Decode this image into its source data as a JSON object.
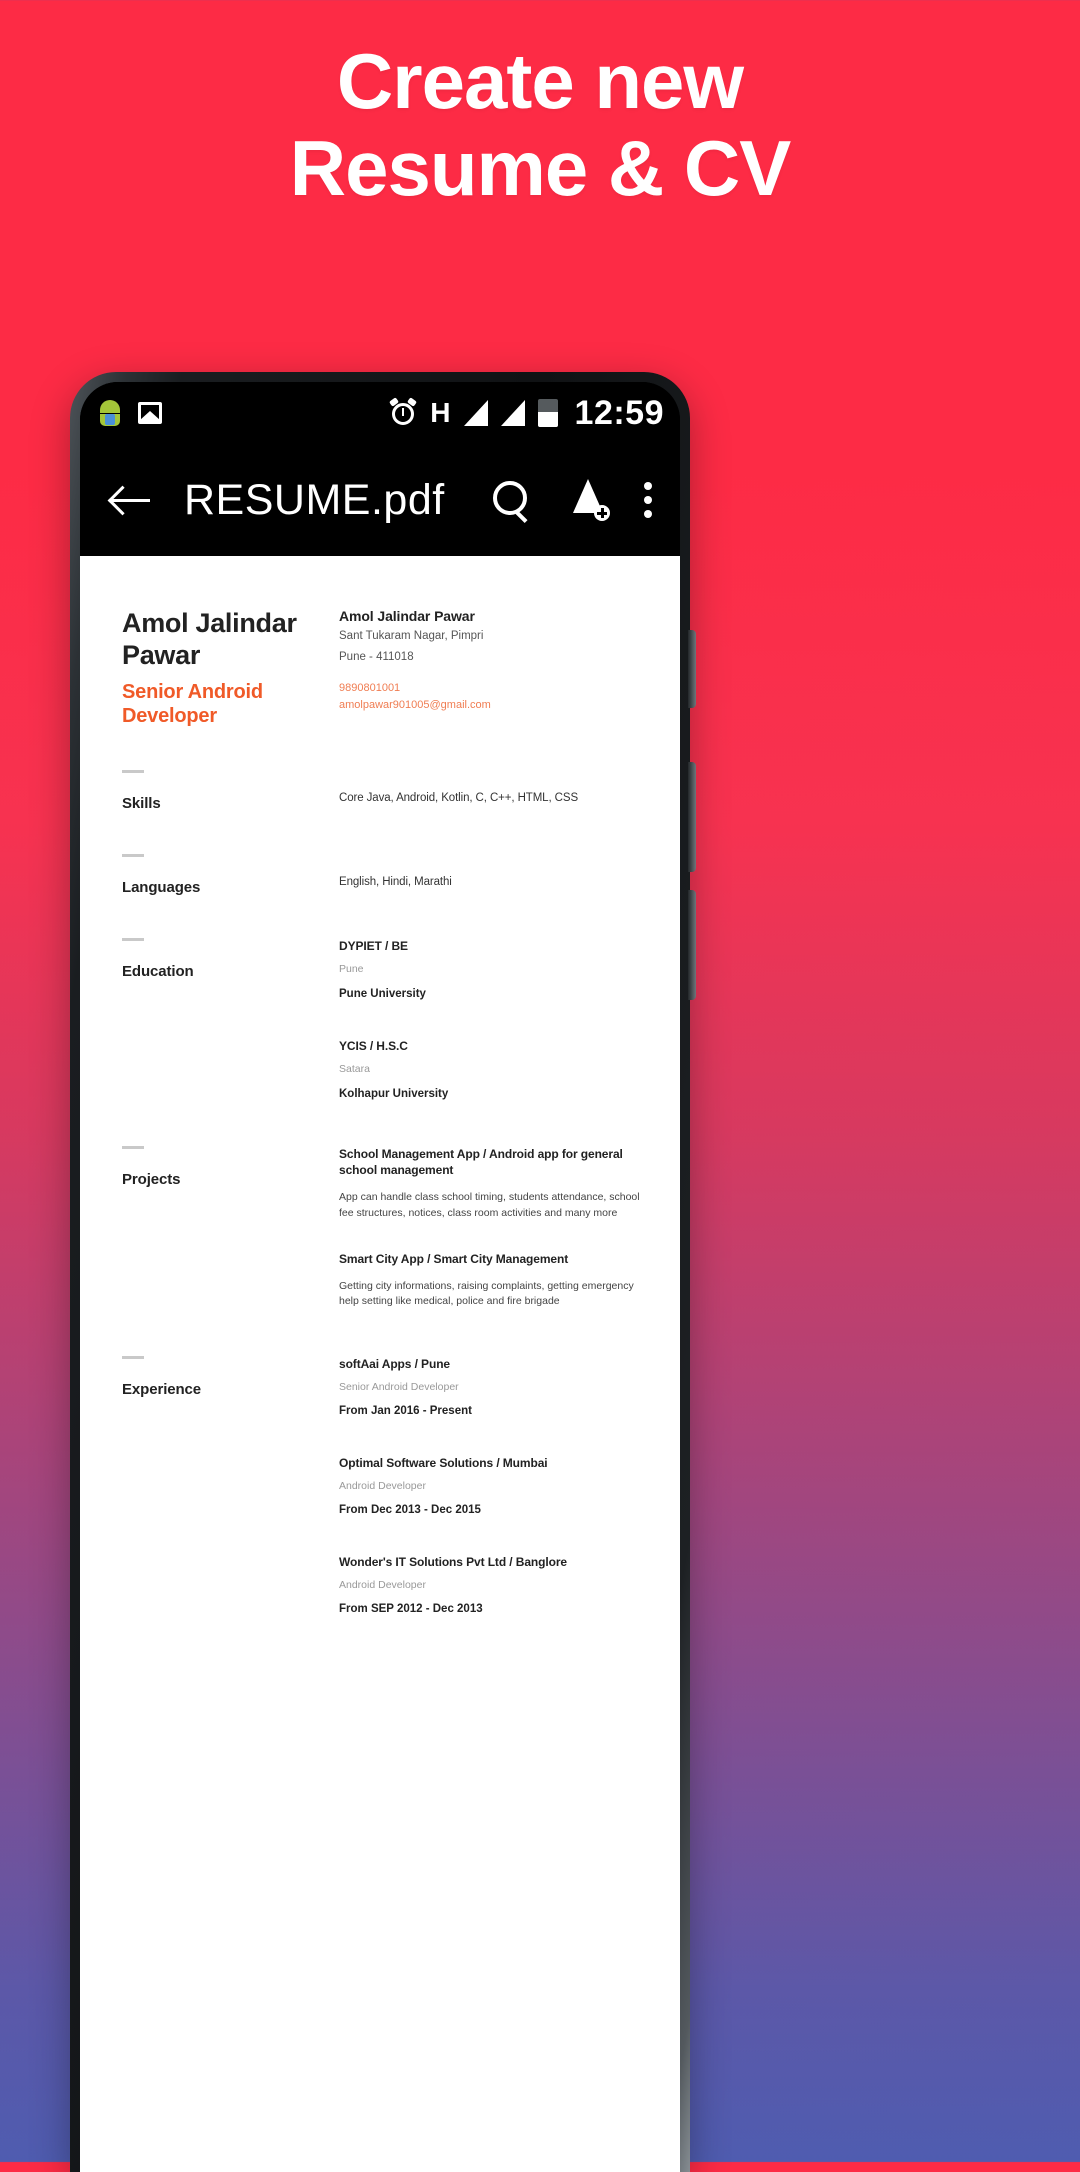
{
  "promo": {
    "headline_line1": "Create new",
    "headline_line2": "Resume & CV",
    "background_top_color": "#fd2b45",
    "background_bottom_color": "#4f5cb0"
  },
  "phone": {
    "statusbar": {
      "icons_left": [
        "android-icon",
        "image-icon"
      ],
      "icons_right": [
        "alarm-icon",
        "hspa-icon",
        "signal-icon",
        "signal-icon",
        "battery-icon"
      ],
      "network_label": "H",
      "time": "12:59"
    },
    "toolbar": {
      "back_label": "back-arrow",
      "title": "RESUME.pdf",
      "search_label": "search",
      "drive_label": "save-to-drive",
      "more_label": "more-options"
    }
  },
  "document": {
    "header": {
      "name": "Amol Jalindar Pawar",
      "role": "Senior Android Developer"
    },
    "contact": {
      "name": "Amol Jalindar Pawar",
      "address_line1": "Sant Tukaram Nagar, Pimpri",
      "address_line2": "Pune - 411018",
      "phone": "9890801001",
      "email": "amolpawar901005@gmail.com"
    },
    "sections": {
      "skills": {
        "label": "Skills",
        "value": "Core Java, Android, Kotlin, C, C++, HTML, CSS"
      },
      "languages": {
        "label": "Languages",
        "value": "English, Hindi, Marathi"
      },
      "education": {
        "label": "Education",
        "items": [
          {
            "title": "DYPIET / BE",
            "place": "Pune",
            "university": "Pune University"
          },
          {
            "title": "YCIS / H.S.C",
            "place": "Satara",
            "university": "Kolhapur University"
          }
        ]
      },
      "projects": {
        "label": "Projects",
        "items": [
          {
            "title": "School Management App / Android app for general school management",
            "description": "App can handle class school timing, students attendance, school fee structures, notices, class room activities and many more"
          },
          {
            "title": "Smart City App / Smart City Management",
            "description": "Getting city informations, raising complaints, getting emergency help setting like medical, police and fire brigade"
          }
        ]
      },
      "experience": {
        "label": "Experience",
        "items": [
          {
            "company": "softAai Apps / Pune",
            "role": "Senior Android Developer",
            "period": "From Jan 2016 - Present"
          },
          {
            "company": "Optimal Software Solutions / Mumbai",
            "role": "Android Developer",
            "period": "From Dec 2013 - Dec 2015"
          },
          {
            "company": "Wonder's IT Solutions Pvt Ltd / Banglore",
            "role": "Android Developer",
            "period": "From SEP 2012 - Dec 2013"
          }
        ]
      }
    }
  }
}
